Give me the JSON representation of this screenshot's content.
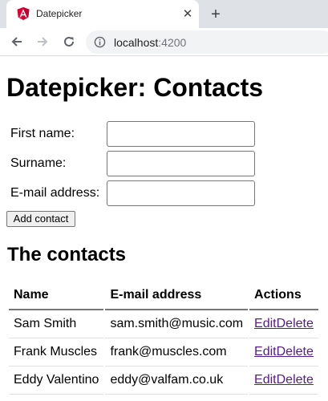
{
  "browser": {
    "tab_title": "Datepicker",
    "close_glyph": "✕",
    "new_tab_glyph": "+",
    "url_host": "localhost",
    "url_port": ":4200",
    "favicon_color": "#dd0031"
  },
  "page": {
    "title": "Datepicker: Contacts",
    "form": {
      "first_name_label": "First name:",
      "surname_label": "Surname:",
      "email_label": "E-mail address:",
      "first_name_value": "",
      "surname_value": "",
      "email_value": "",
      "add_button": "Add contact"
    },
    "contacts_heading": "The contacts",
    "table": {
      "headers": [
        "Name",
        "E-mail address",
        "Actions"
      ],
      "rows": [
        {
          "name": "Sam Smith",
          "email": "sam.smith@music.com",
          "edit": "Edit",
          "delete": "Delete"
        },
        {
          "name": "Frank Muscles",
          "email": "frank@muscles.com",
          "edit": "Edit",
          "delete": "Delete"
        },
        {
          "name": "Eddy Valentino",
          "email": "eddy@valfam.co.uk",
          "edit": "Edit",
          "delete": "Delete"
        }
      ]
    }
  },
  "colors": {
    "link": "#551a8b",
    "tabstrip": "#dee1e6"
  }
}
